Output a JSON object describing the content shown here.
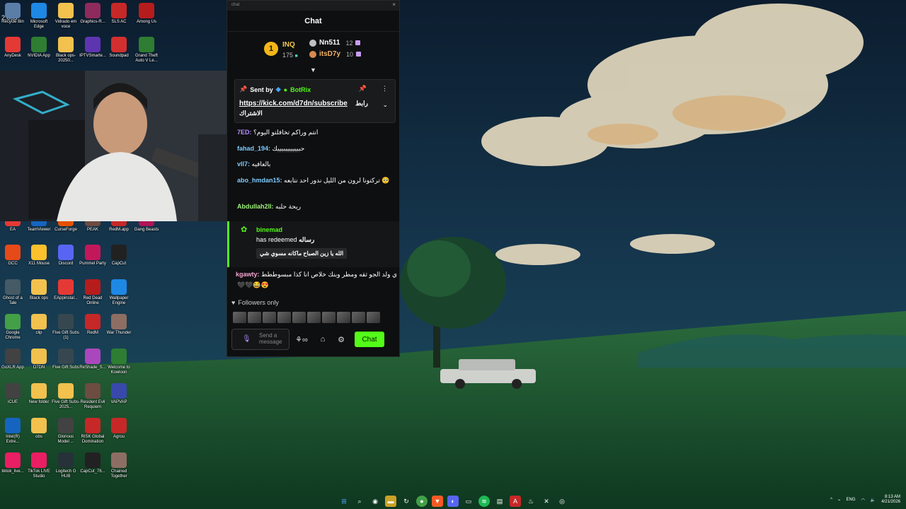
{
  "overlay": {
    "fps_text": "2.005"
  },
  "desktop_icons": [
    {
      "label": "Recycle Bin",
      "icon": "recycle-bin-icon",
      "color": "#5b7ea8"
    },
    {
      "label": "Microsoft Edge",
      "icon": "edge-icon",
      "color": "#1e88e5"
    },
    {
      "label": "Vidrado em voce",
      "icon": "folder-icon",
      "color": "#f2c14e"
    },
    {
      "label": "Graphics-R...",
      "icon": "winrar-icon",
      "color": "#8e2b5c"
    },
    {
      "label": "SLS AC",
      "icon": "adobe-icon",
      "color": "#c62828"
    },
    {
      "label": "Among Us",
      "icon": "among-us-icon",
      "color": "#b71c1c"
    },
    {
      "label": "AnyDesk",
      "icon": "anydesk-icon",
      "color": "#e53935"
    },
    {
      "label": "NVIDIA App",
      "icon": "nvidia-icon",
      "color": "#2e7d32"
    },
    {
      "label": "Black ops-20250...",
      "icon": "folder-icon",
      "color": "#f2c14e"
    },
    {
      "label": "IPTVSmarte...",
      "icon": "iptv-icon",
      "color": "#5e35b1"
    },
    {
      "label": "Soundpad",
      "icon": "soundpad-icon",
      "color": "#d32f2f"
    },
    {
      "label": "Grand Theft Auto V Le...",
      "icon": "gta-icon",
      "color": "#2e7d32"
    },
    {
      "label": "EA",
      "icon": "ea-icon",
      "color": "#e53935"
    },
    {
      "label": "TeamViewer",
      "icon": "teamviewer-icon",
      "color": "#1565c0"
    },
    {
      "label": "CurseForge",
      "icon": "curseforge-icon",
      "color": "#e65100"
    },
    {
      "label": "PEAK",
      "icon": "peak-icon",
      "color": "#6d4c41"
    },
    {
      "label": "RedM.app",
      "icon": "redm-icon",
      "color": "#c62828"
    },
    {
      "label": "Gang Beasts",
      "icon": "gang-beasts-icon",
      "color": "#ad1457"
    },
    {
      "label": "GCC",
      "icon": "gcc-icon",
      "color": "#e64a19"
    },
    {
      "label": "X11 Mouse",
      "icon": "mouse-icon",
      "color": "#fbc02d"
    },
    {
      "label": "Discord",
      "icon": "discord-icon",
      "color": "#5865f2"
    },
    {
      "label": "Pummel Party",
      "icon": "pummel-party-icon",
      "color": "#c2185b"
    },
    {
      "label": "CapCut",
      "icon": "capcut-icon",
      "color": "#212121"
    },
    {
      "label": "Ghost of a Tale",
      "icon": "ghost-of-a-tale-icon",
      "color": "#455a64"
    },
    {
      "label": "Black ops",
      "icon": "folder-icon",
      "color": "#f2c14e"
    },
    {
      "label": "EAppinstal...",
      "icon": "ea-installer-icon",
      "color": "#e53935"
    },
    {
      "label": "Red Dead Online",
      "icon": "red-dead-icon",
      "color": "#b71c1c"
    },
    {
      "label": "Wallpaper Engine",
      "icon": "wallpaper-engine-icon",
      "color": "#1e88e5"
    },
    {
      "label": "Google Chrome",
      "icon": "chrome-icon",
      "color": "#43a047"
    },
    {
      "label": "clip",
      "icon": "folder-icon",
      "color": "#f2c14e"
    },
    {
      "label": "Five Gift Subs (1)",
      "icon": "video-file-icon",
      "color": "#37474f"
    },
    {
      "label": "RedM",
      "icon": "redm-icon",
      "color": "#c62828"
    },
    {
      "label": "War Thunder",
      "icon": "war-thunder-icon",
      "color": "#8d6e63"
    },
    {
      "label": "GoXLR App",
      "icon": "goxlr-icon",
      "color": "#424242"
    },
    {
      "label": "D7DN",
      "icon": "folder-icon",
      "color": "#f2c14e"
    },
    {
      "label": "Five Gift Subs",
      "icon": "video-file-icon",
      "color": "#37474f"
    },
    {
      "label": "ReShade_S...",
      "icon": "reshade-icon",
      "color": "#ab47bc"
    },
    {
      "label": "Welcome to Kowloon",
      "icon": "kowloon-icon",
      "color": "#2e7d32"
    },
    {
      "label": "iCUE",
      "icon": "icue-icon",
      "color": "#424242"
    },
    {
      "label": "New folder",
      "icon": "folder-icon",
      "color": "#f2c14e"
    },
    {
      "label": "Five Gift Subs-2025...",
      "icon": "folder-icon",
      "color": "#f2c14e"
    },
    {
      "label": "Resident Evil Requiem",
      "icon": "resident-evil-icon",
      "color": "#6d4c41"
    },
    {
      "label": "VAPVAP",
      "icon": "vapvap-icon",
      "color": "#3949ab"
    },
    {
      "label": "Intel(R) Extre...",
      "icon": "intel-icon",
      "color": "#1565c0"
    },
    {
      "label": "obs",
      "icon": "folder-icon",
      "color": "#f2c14e"
    },
    {
      "label": "Glorious Model ...",
      "icon": "glorious-icon",
      "color": "#424242"
    },
    {
      "label": "RISK Global Domination",
      "icon": "risk-icon",
      "color": "#c62828"
    },
    {
      "label": "Agrou",
      "icon": "agrou-icon",
      "color": "#c62828"
    },
    {
      "label": "tiktok_live...",
      "icon": "tiktok-icon",
      "color": "#e91e63"
    },
    {
      "label": "TikTok LIVE Studio",
      "icon": "tiktok-studio-icon",
      "color": "#e91e63"
    },
    {
      "label": "Logitech G HUB",
      "icon": "logitech-icon",
      "color": "#263238"
    },
    {
      "label": "CapCut_76...",
      "icon": "capcut-icon",
      "color": "#212121"
    },
    {
      "label": "Chained Together",
      "icon": "chained-together-icon",
      "color": "#8d6e63"
    }
  ],
  "chat": {
    "window_title": "chat",
    "header": "Chat",
    "leader1": {
      "rank": "1",
      "name": "INQ",
      "count": "175"
    },
    "leader2": {
      "name": "Nn511",
      "count": "12"
    },
    "leader3": {
      "name": "itsD7y",
      "count": "10"
    },
    "pinned": {
      "sent_by": "Sent by",
      "bot_name": "BotRix",
      "link": "https://kick.com/d7dn/subscribe",
      "text_ar": "رابط",
      "text_ar2": "الاشتراك"
    },
    "messages": [
      {
        "user": "7ED:",
        "text": "انتم وراكم تخافلتو اليوم؟",
        "color": "#b48bff"
      },
      {
        "user": "fahad_194:",
        "text": "حبيييييييبيييك",
        "color": "#7ecbff"
      },
      {
        "user": "vll7:",
        "text": "بالعافيه",
        "color": "#7ecbff"
      },
      {
        "user": "abo_hmdan15:",
        "text": "تركتونا لرون من الليل ندور احد نتابعه 🥺",
        "color": "#7ecbff"
      },
      {
        "user": "Abdullah2ll:",
        "text": "ريحة حلبه",
        "color": "#9df57a"
      }
    ],
    "redeem": {
      "user": "binemad",
      "text": "has redeemed",
      "reward_name": "رساله",
      "reward_text": "الله يا زين الصباح ماكانه مسوي شي"
    },
    "last_message": {
      "user": "kgawty:",
      "text": "ي ولد الجو ثقه ومطر وبنك خلاص انا كذا مبسوططط",
      "emotes": "🖤🖤😂😍",
      "color": "#f2a6d0"
    },
    "followers_label": "Followers only",
    "input_placeholder": "Send a message",
    "send_label": "Chat"
  },
  "taskbar": {
    "lang": "ENG",
    "time": "8:13 AM",
    "date": "4/21/2026"
  }
}
